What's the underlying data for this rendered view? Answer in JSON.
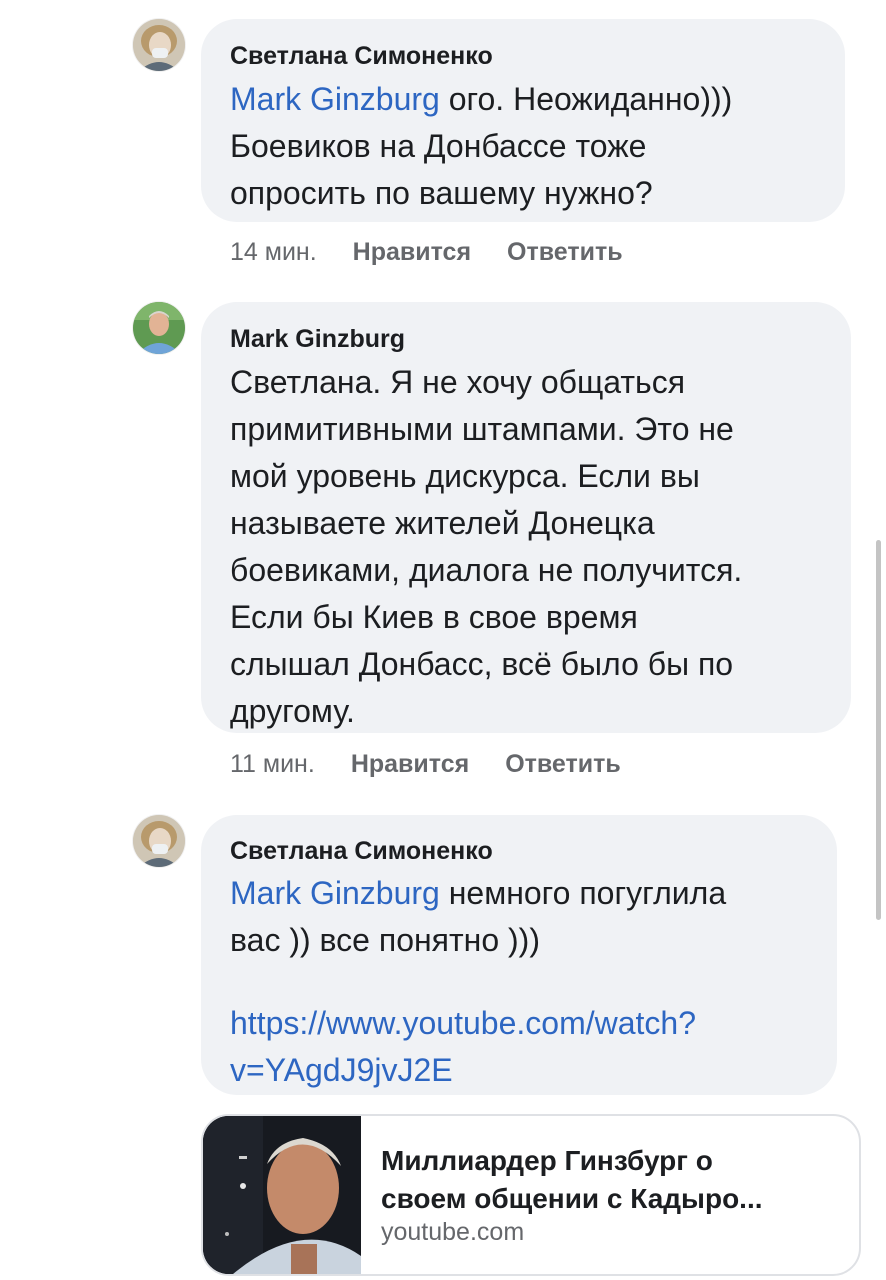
{
  "comments": [
    {
      "author": "Светлана Симоненко",
      "lines": [
        {
          "mention": "Mark Ginzburg",
          "text": " ого. Неожиданно)))"
        },
        {
          "text": "Боевиков на Донбассе тоже"
        },
        {
          "text": "опросить по вашему нужно?"
        }
      ],
      "time": "14 мин.",
      "like_label": "Нравится",
      "reply_label": "Ответить"
    },
    {
      "author": "Mark Ginzburg",
      "lines": [
        "Светлана. Я не хочу общаться",
        "примитивными штампами. Это не",
        "мой уровень дискурса. Если вы",
        "называете жителей Донецка",
        "боевиками, диалога не получится.",
        "Если бы Киев в свое время",
        "слышал Донбасс, всё было бы по",
        "другому."
      ],
      "time": "11 мин.",
      "like_label": "Нравится",
      "reply_label": "Ответить"
    },
    {
      "author": "Светлана Симоненко",
      "lines": [
        {
          "mention": "Mark Ginzburg",
          "text": " немного погуглила"
        },
        {
          "text": "вас )) все понятно )))"
        }
      ],
      "link_lines": [
        "https://www.youtube.com/watch?",
        "v=YAgdJ9jvJ2E"
      ]
    }
  ],
  "link_preview": {
    "title_lines": [
      "Миллиардер Гинзбург о",
      "своем общении с Кадыро..."
    ],
    "domain": "youtube.com"
  },
  "icons": [
    "avatar-svetlana",
    "avatar-mark",
    "video-thumbnail"
  ],
  "colors": {
    "bubble": "#f0f2f5",
    "mention": "#2d66c2",
    "meta": "#65676b",
    "text": "#1c1e21"
  }
}
